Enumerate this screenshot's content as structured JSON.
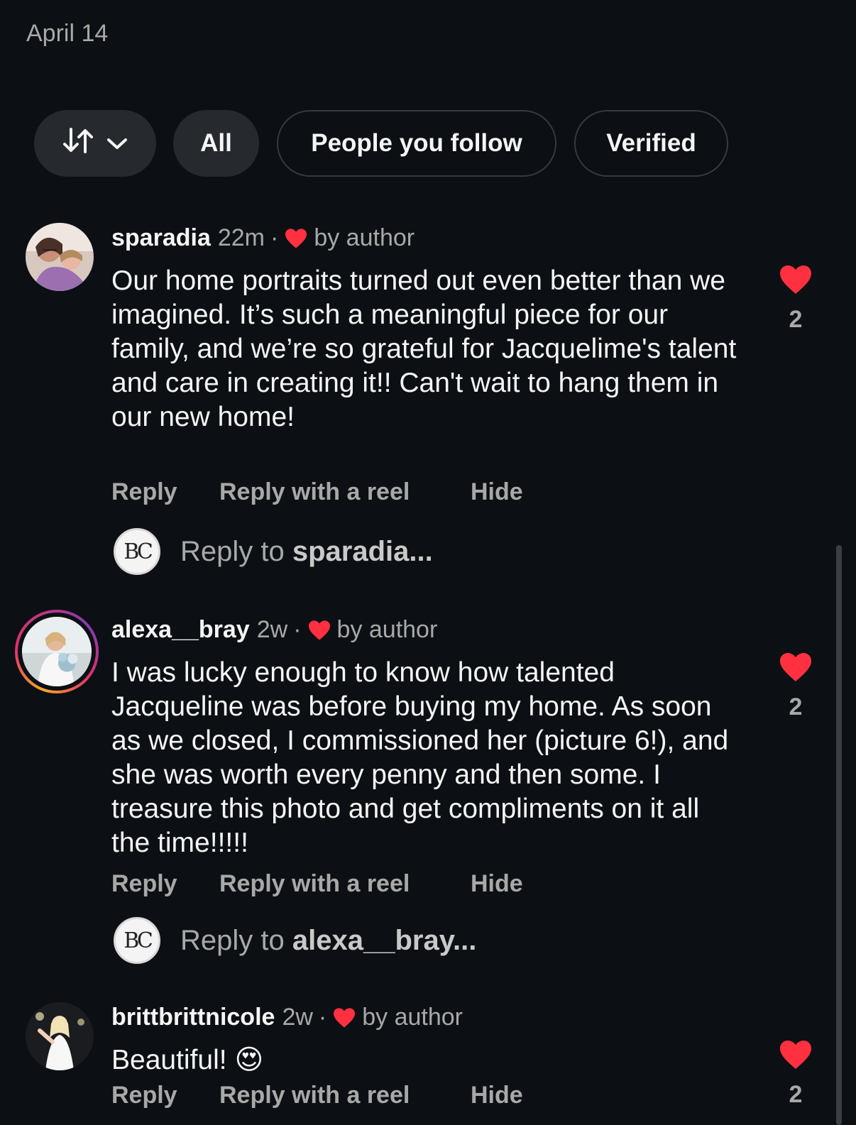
{
  "post": {
    "date": "April 14"
  },
  "filters": {
    "all": "All",
    "people_you_follow": "People you follow",
    "verified": "Verified"
  },
  "icons": {
    "sort": "sort-arrows-icon",
    "chevron": "chevron-down-icon",
    "heart": "heart-icon"
  },
  "colors": {
    "background": "#0c1014",
    "like_red": "#ff3040",
    "muted": "#a8a8a8"
  },
  "comments": [
    {
      "username": "sparadia",
      "time": "22m",
      "liked_by": "by author",
      "text": "Our home portraits turned out even better than we imagined. It’s such a meaningful piece for our family, and we’re so grateful for Jacquelime's talent and care in creating it!! Can't wait to hang them in our new home!",
      "reply": "Reply",
      "reply_reel": "Reply with a reel",
      "hide": "Hide",
      "likes": "2",
      "reply_prompt": "Reply to ",
      "reply_target": "sparadia..."
    },
    {
      "username": "alexa__bray",
      "time": "2w",
      "liked_by": "by author",
      "text": "I was lucky enough to know how talented Jacqueline was before buying my home. As soon as we closed, I commissioned her (picture 6!), and she was worth every penny and then some. I treasure this photo and get compliments on it all the time!!!!!",
      "reply": "Reply",
      "reply_reel": "Reply with a reel",
      "hide": "Hide",
      "likes": "2",
      "reply_prompt": "Reply to ",
      "reply_target": "alexa__bray..."
    },
    {
      "username": "brittbrittnicole",
      "time": "2w",
      "liked_by": "by author",
      "text": "Beautiful! 😍",
      "reply": "Reply",
      "reply_reel": "Reply with a reel",
      "hide": "Hide",
      "likes": "2"
    }
  ],
  "my_avatar": {
    "monogram": "BC"
  }
}
